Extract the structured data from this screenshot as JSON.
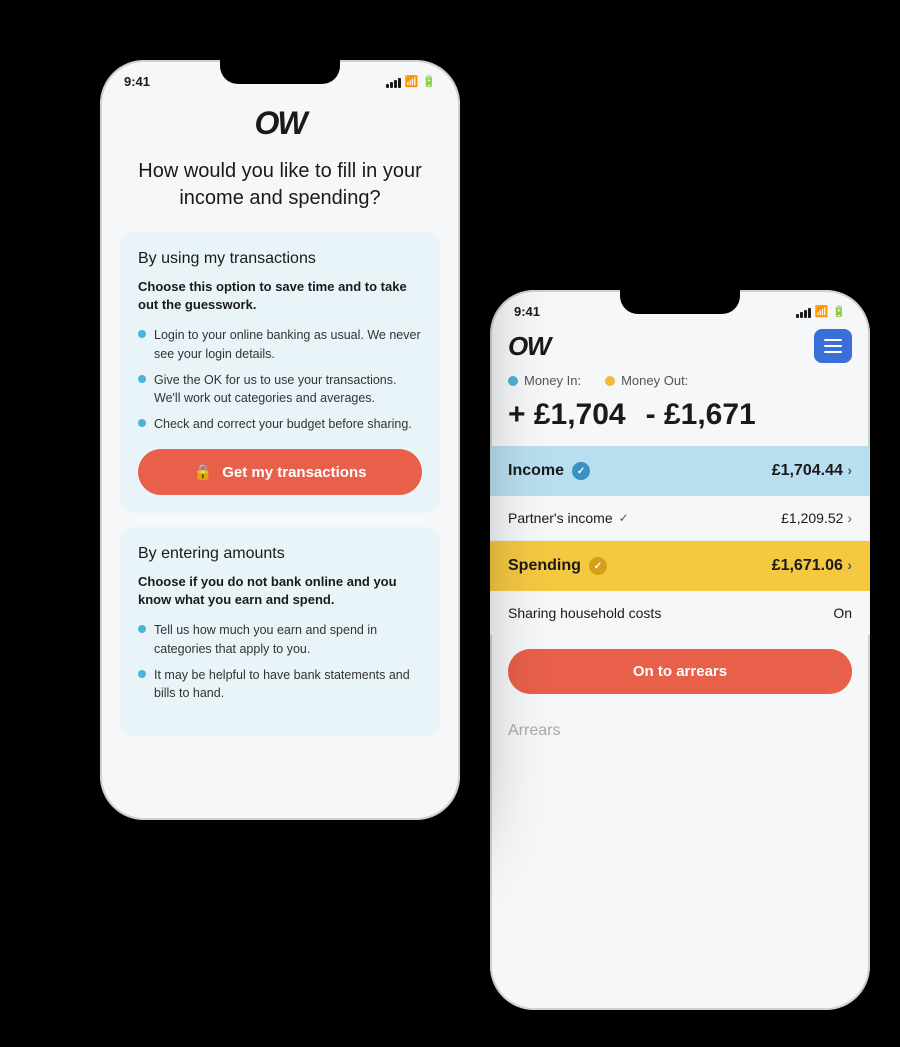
{
  "phone1": {
    "status": {
      "time": "9:41"
    },
    "logo": "OW",
    "question": "How would you like to fill in your income and spending?",
    "option1": {
      "title": "By using my transactions",
      "subtitle": "Choose this option to save time and to take out the guesswork.",
      "bullets": [
        "Login to your online banking as usual. We never see your login details.",
        "Give the OK for us to use your transactions. We'll work out categories and averages.",
        "Check and correct your budget before sharing."
      ],
      "button": "Get my transactions"
    },
    "option2": {
      "title": "By entering amounts",
      "subtitle": "Choose if you do not bank online and you know what you earn and spend.",
      "bullets": [
        "Tell us how much you earn and spend in categories that apply to you.",
        "It may be helpful to have bank statements and bills to hand."
      ]
    }
  },
  "phone2": {
    "status": {
      "time": "9:41"
    },
    "logo": "OW",
    "money_in_label": "Money In:",
    "money_out_label": "Money Out:",
    "amount_in": "+ £1,704",
    "amount_out": "- £1,671",
    "income_label": "Income",
    "income_amount": "£1,704.44",
    "partner_label": "Partner's income",
    "partner_amount": "£1,209.52",
    "spending_label": "Spending",
    "spending_amount": "£1,671.06",
    "sharing_label": "Sharing household costs",
    "sharing_status": "On",
    "button_arrears": "On to arrears",
    "arrears_label": "Arrears"
  }
}
